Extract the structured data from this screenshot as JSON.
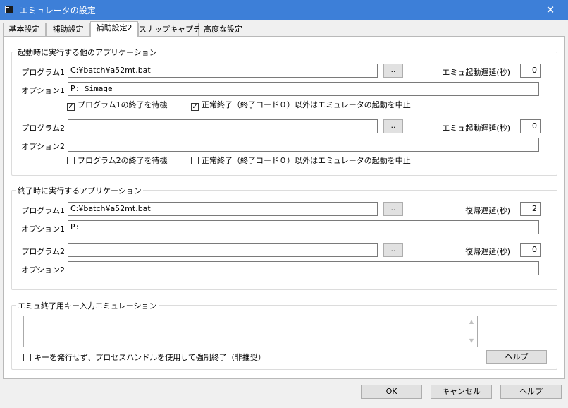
{
  "window": {
    "title": "エミュレータの設定"
  },
  "tabs": [
    "基本設定",
    "補助設定",
    "補助設定2",
    "スナップキャプチャ",
    "高度な設定"
  ],
  "startup_group": {
    "legend": "起動時に実行する他のアプリケーション",
    "program1_label": "プログラム1",
    "program1_value": "C:¥batch¥a52mt.bat",
    "browse_label": "..",
    "delay_label": "エミュ起動遅延(秒)",
    "delay1_value": "0",
    "option1_label": "オプション1",
    "option1_value": "P: $image",
    "wait1_label": "プログラム1の終了を待機",
    "wait1_checked": true,
    "abort1_label": "正常終了（終了コード０）以外はエミュレータの起動を中止",
    "abort1_checked": true,
    "program2_label": "プログラム2",
    "program2_value": "",
    "delay2_value": "0",
    "option2_label": "オプション2",
    "option2_value": "",
    "wait2_label": "プログラム2の終了を待機",
    "wait2_checked": false,
    "abort2_label": "正常終了（終了コード０）以外はエミュレータの起動を中止",
    "abort2_checked": false
  },
  "exit_group": {
    "legend": "終了時に実行するアプリケーション",
    "program1_label": "プログラム1",
    "program1_value": "C:¥batch¥a52mt.bat",
    "browse_label": "..",
    "delay_label": "復帰遅延(秒)",
    "delay1_value": "2",
    "option1_label": "オプション1",
    "option1_value": "P:",
    "program2_label": "プログラム2",
    "program2_value": "",
    "delay2_value": "0",
    "option2_label": "オプション2",
    "option2_value": ""
  },
  "key_group": {
    "legend": "エミュ終了用キー入力エミュレーション",
    "force_label": "キーを発行せず、プロセスハンドルを使用して強制終了（非推奨）",
    "force_checked": false,
    "help_label": "ヘルプ"
  },
  "footer": {
    "ok": "OK",
    "cancel": "キャンセル",
    "help": "ヘルプ"
  }
}
